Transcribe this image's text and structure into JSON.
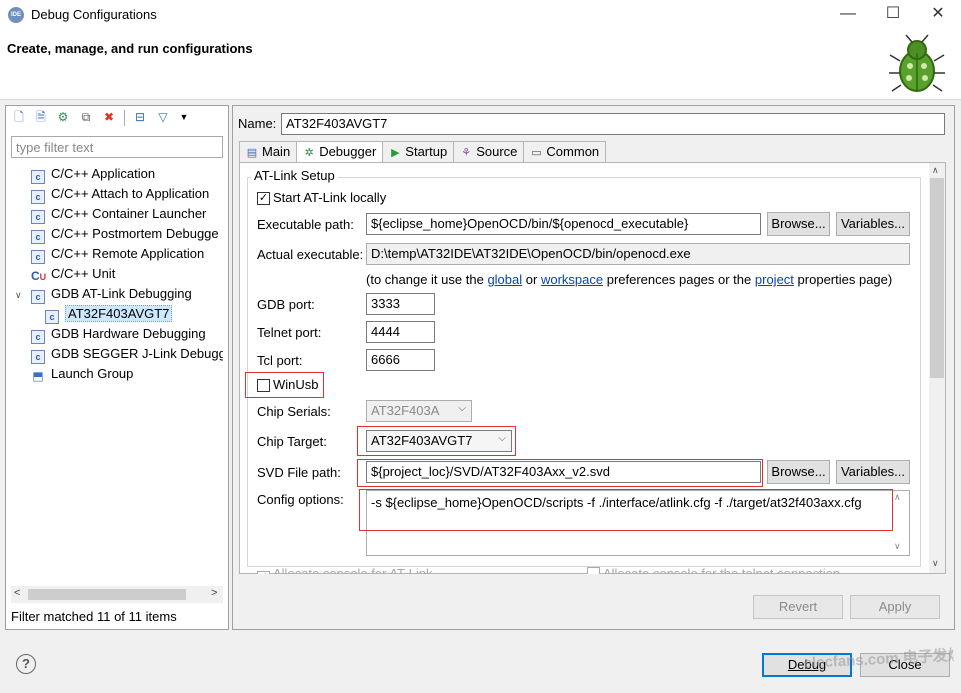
{
  "window": {
    "app_icon_text": "IDE",
    "title": "Debug Configurations",
    "minimize": "—",
    "maximize": "☐",
    "close": "✕"
  },
  "header": {
    "title": "Create, manage, and run configurations"
  },
  "left": {
    "filter_placeholder": "type filter text",
    "tree": [
      {
        "label": "C/C++ Application",
        "icon": "c-icon"
      },
      {
        "label": "C/C++ Attach to Application",
        "icon": "c-icon"
      },
      {
        "label": "C/C++ Container Launcher",
        "icon": "c-icon"
      },
      {
        "label": "C/C++ Postmortem Debugge",
        "icon": "c-icon"
      },
      {
        "label": "C/C++ Remote Application",
        "icon": "c-icon"
      },
      {
        "label": "C/C++ Unit",
        "icon": "cu-icon"
      },
      {
        "label": "GDB AT-Link Debugging",
        "icon": "c-icon",
        "expanded": true
      },
      {
        "label": "AT32F403AVGT7",
        "icon": "c-icon",
        "selected": true
      },
      {
        "label": "GDB Hardware Debugging",
        "icon": "c-icon"
      },
      {
        "label": "GDB SEGGER J-Link Debuggir",
        "icon": "c-icon"
      },
      {
        "label": "Launch Group",
        "icon": "launch-group-icon"
      }
    ],
    "filter_status": "Filter matched 11 of 11 items"
  },
  "right": {
    "name_label": "Name:",
    "name_value": "AT32F403AVGT7",
    "tabs": [
      {
        "label": "Main",
        "icon": "main-icon"
      },
      {
        "label": "Debugger",
        "icon": "debugger-icon",
        "active": true
      },
      {
        "label": "Startup",
        "icon": "startup-icon"
      },
      {
        "label": "Source",
        "icon": "source-icon"
      },
      {
        "label": "Common",
        "icon": "common-icon"
      }
    ],
    "group_title": "AT-Link Setup",
    "start_locally": "Start AT-Link locally",
    "exec_label": "Executable path:",
    "exec_value": "${eclipse_home}OpenOCD/bin/${openocd_executable}",
    "browse": "Browse...",
    "variables": "Variables...",
    "actual_label": "Actual executable:",
    "actual_value": "D:\\temp\\AT32IDE\\AT32IDE\\OpenOCD/bin/openocd.exe",
    "hint_pre": "(to change it use the",
    "hint_global": "global",
    "hint_or": "or",
    "hint_workspace": "workspace",
    "hint_mid": "preferences pages or the",
    "hint_project": "project",
    "hint_post": "properties page)",
    "gdb_port_label": "GDB port:",
    "gdb_port": "3333",
    "telnet_port_label": "Telnet port:",
    "telnet_port": "4444",
    "tcl_port_label": "Tcl port:",
    "tcl_port": "6666",
    "winusb": "WinUsb",
    "chip_serials_label": "Chip Serials:",
    "chip_serials": "AT32F403A",
    "chip_target_label": "Chip Target:",
    "chip_target": "AT32F403AVGT7",
    "svd_label": "SVD File path:",
    "svd_value": "${project_loc}/SVD/AT32F403Axx_v2.svd",
    "config_label": "Config options:",
    "config_value": "-s ${eclipse_home}OpenOCD/scripts -f ./interface/atlink.cfg -f ./target/at32f403axx.cfg",
    "alloc_console": "Allocate console for AT-Link",
    "alloc_telnet": "Allocate console for the telnet connection",
    "revert": "Revert",
    "apply": "Apply"
  },
  "footer": {
    "help": "?",
    "debug": "Debug",
    "close": "Close",
    "watermark": "elecfans.com 电子发烧友"
  }
}
